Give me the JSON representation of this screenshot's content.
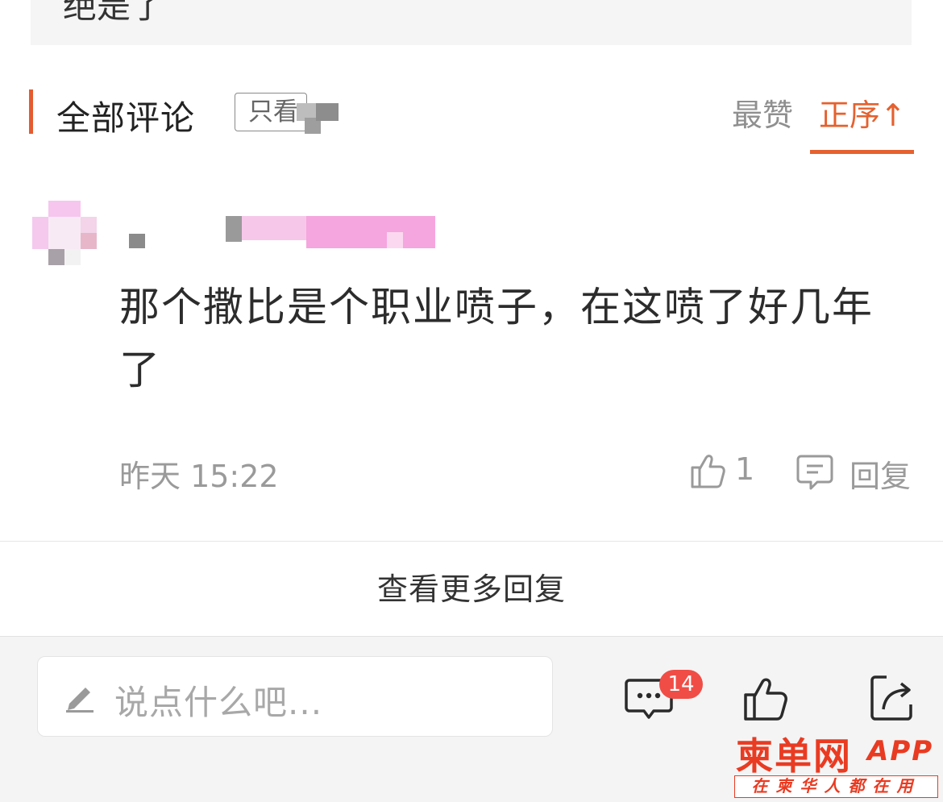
{
  "prev_post": {
    "text_fragment": "绝是了"
  },
  "comments_section": {
    "title": "全部评论",
    "only_author_label": "只看",
    "sort_hot": "最赞",
    "sort_order": "正序↑"
  },
  "comment": {
    "text": "那个撒比是个职业喷子，在这喷了好几年了",
    "time": "昨天 15:22",
    "like_count": "1",
    "reply_label": "回复"
  },
  "more_replies": "查看更多回复",
  "bottom_bar": {
    "input_placeholder": "说点什么吧...",
    "comment_badge": "14"
  },
  "watermark": {
    "logo": "柬单网",
    "app": "APP",
    "slogan": "在柬华人都在用"
  },
  "colors": {
    "accent": "#e5612f",
    "badge": "#f04d46",
    "watermark": "#e93b22"
  },
  "icons": [
    "pencil-icon",
    "chat-bubble-icon",
    "thumb-up-icon",
    "share-icon",
    "reply-icon",
    "like-icon"
  ]
}
